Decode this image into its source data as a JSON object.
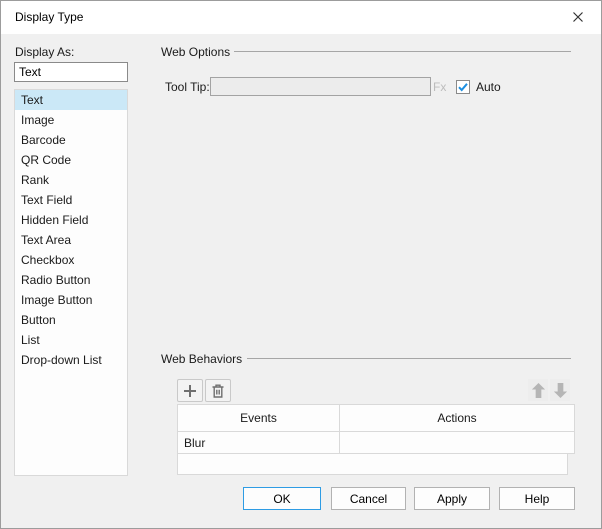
{
  "dialog": {
    "title": "Display Type"
  },
  "display_as": {
    "label": "Display As:",
    "value": "Text",
    "items": [
      "Text",
      "Image",
      "Barcode",
      "QR Code",
      "Rank",
      "Text Field",
      "Hidden Field",
      "Text Area",
      "Checkbox",
      "Radio Button",
      "Image Button",
      "Button",
      "List",
      "Drop-down List"
    ],
    "selected": "Text"
  },
  "web_options": {
    "title": "Web Options",
    "tooltip_label": "Tool Tip:",
    "tooltip_value": "",
    "fx_label": "Fx",
    "auto_label": "Auto",
    "auto_checked": true
  },
  "web_behaviors": {
    "title": "Web Behaviors",
    "table": {
      "headers": [
        "Events",
        "Actions"
      ],
      "rows": [
        {
          "event": "Blur",
          "action": ""
        }
      ]
    }
  },
  "footer": {
    "ok_label": "OK",
    "cancel_label": "Cancel",
    "apply_label": "Apply",
    "help_label": "Help"
  },
  "colors": {
    "accent_blue": "#2e9ce4",
    "selection_blue": "#cbe8f7",
    "check_blue": "#1d8fe1"
  }
}
